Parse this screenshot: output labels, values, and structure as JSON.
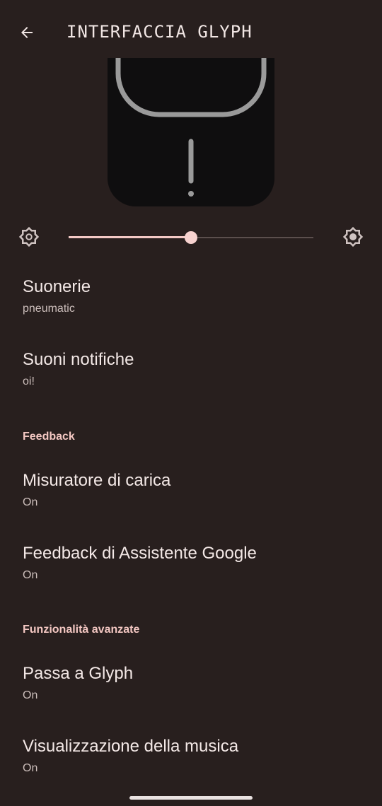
{
  "header": {
    "title": "INTERFACCIA GLYPH",
    "back_icon": "arrow-back-icon"
  },
  "brightness": {
    "low_icon": "brightness-low-icon",
    "high_icon": "brightness-high-icon",
    "level": 0.5
  },
  "sections": {
    "feedback": "Feedback",
    "advanced": "Funzionalità avanzate"
  },
  "items": [
    {
      "title": "Suonerie",
      "summary": "pneumatic"
    },
    {
      "title": "Suoni notifiche",
      "summary": "oi!"
    },
    {
      "title": "Misuratore di carica",
      "summary": "On"
    },
    {
      "title": "Feedback di Assistente Google",
      "summary": "On"
    },
    {
      "title": "Passa a Glyph",
      "summary": "On"
    },
    {
      "title": "Visualizzazione della musica",
      "summary": "On"
    }
  ],
  "colors": {
    "background": "#281f1e",
    "accent": "#f3c7c2",
    "preview_body": "#0f0e0f",
    "glyph_light": "#9a9a9a"
  }
}
